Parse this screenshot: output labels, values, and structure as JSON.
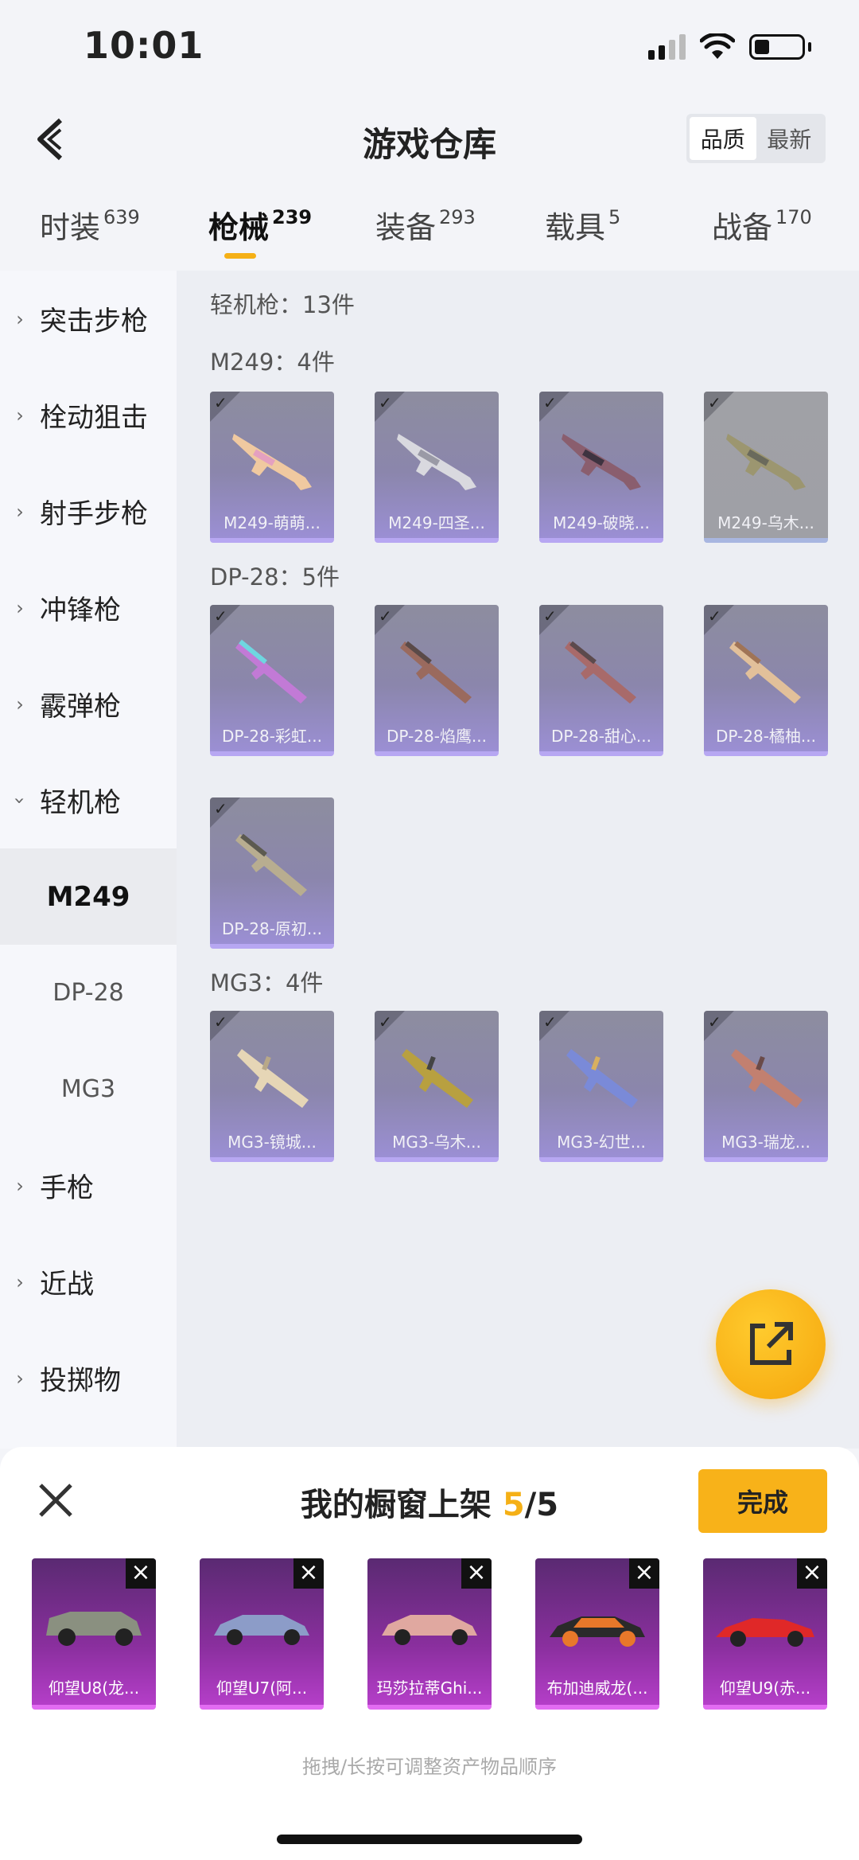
{
  "status": {
    "time": "10:01"
  },
  "header": {
    "title": "游戏仓库",
    "sort_quality": "品质",
    "sort_newest": "最新"
  },
  "tabs": [
    {
      "label": "时装",
      "count": "639"
    },
    {
      "label": "枪械",
      "count": "239"
    },
    {
      "label": "装备",
      "count": "293"
    },
    {
      "label": "载具",
      "count": "5"
    },
    {
      "label": "战备",
      "count": "170"
    }
  ],
  "sidebar": {
    "items": [
      "突击步枪",
      "栓动狙击",
      "射手步枪",
      "冲锋枪",
      "霰弹枪",
      "轻机枪"
    ],
    "subitems": [
      "M249",
      "DP-28",
      "MG3"
    ],
    "more": [
      "手枪",
      "近战",
      "投掷物"
    ]
  },
  "content": {
    "category_label": "轻机枪：13件",
    "groups": [
      {
        "label": "M249：4件",
        "items": [
          "M249-萌萌...",
          "M249-四圣...",
          "M249-破晓...",
          "M249-乌木..."
        ]
      },
      {
        "label": "DP-28：5件",
        "items": [
          "DP-28-彩虹...",
          "DP-28-焰鹰...",
          "DP-28-甜心...",
          "DP-28-橘柚...",
          "DP-28-原初..."
        ]
      },
      {
        "label": "MG3：4件",
        "items": [
          "MG3-镜城...",
          "MG3-乌木...",
          "MG3-幻世...",
          "MG3-瑞龙..."
        ]
      }
    ]
  },
  "showcase": {
    "title_prefix": "我的橱窗上架",
    "count": "5",
    "total": "/5",
    "done": "完成",
    "items": [
      "仰望U8(龙...",
      "仰望U7(阿...",
      "玛莎拉蒂Ghi...",
      "布加迪威龙(...",
      "仰望U9(赤..."
    ],
    "hint": "拖拽/长按可调整资产物品顺序"
  }
}
